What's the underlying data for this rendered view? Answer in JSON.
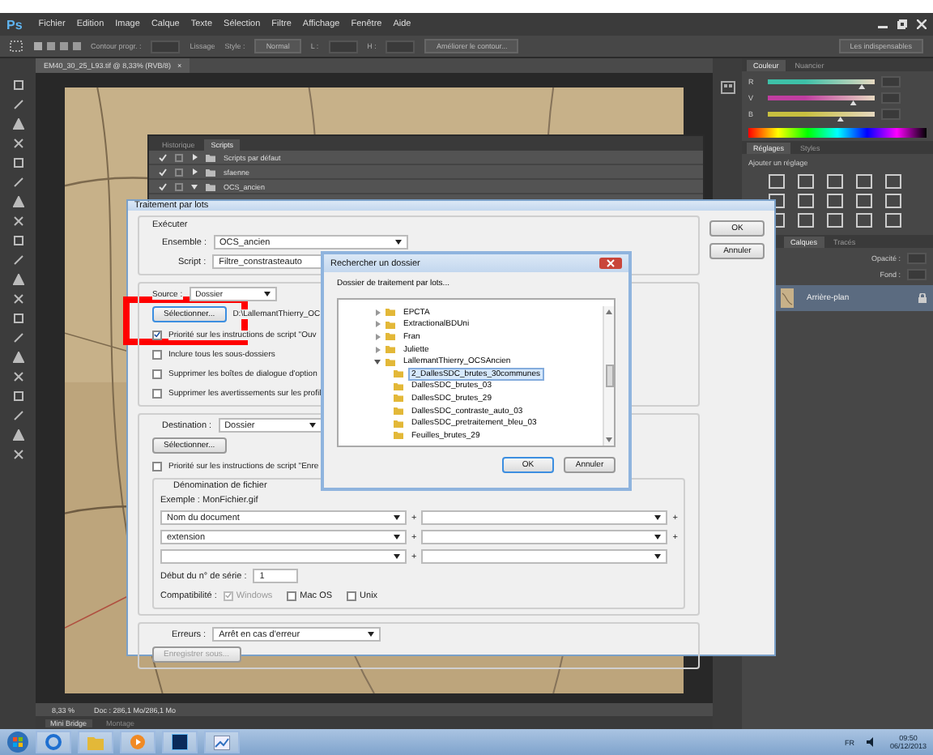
{
  "menu_bar": {
    "logo": "Ps",
    "items": [
      "Fichier",
      "Edition",
      "Image",
      "Calque",
      "Texte",
      "Sélection",
      "Filtre",
      "Affichage",
      "Fenêtre",
      "Aide"
    ]
  },
  "options_bar": {
    "feather_label": "Contour progr. :",
    "smooth": "Lissage",
    "style_label": "Style :",
    "style_value": "Normal",
    "width_label": "L :",
    "height_label": "H :",
    "refine": "Améliorer le contour...",
    "workspace": "Les indispensables"
  },
  "document_tab": {
    "title": "EM40_30_25_L93.tif @ 8,33% (RVB/8)",
    "close": "×"
  },
  "status_bar": {
    "zoom": "8,33 %",
    "doc": "Doc : 286,1 Mo/286,1 Mo"
  },
  "bottom_tabs": [
    {
      "label": "Mini Bridge",
      "selected": true
    },
    {
      "label": "Montage",
      "selected": false
    }
  ],
  "scripts_panel": {
    "tabs": [
      {
        "label": "Historique",
        "selected": false
      },
      {
        "label": "Scripts",
        "selected": true
      }
    ],
    "rows": [
      {
        "label": "Scripts par défaut",
        "expanded": false
      },
      {
        "label": "sfaenne",
        "expanded": false
      },
      {
        "label": "OCS_ancien",
        "expanded": true
      }
    ]
  },
  "batch_dialog": {
    "title": "Traitement par lots",
    "buttons": [
      "OK",
      "Annuler"
    ],
    "execute": {
      "legend": "Exécuter",
      "set_label": "Ensemble :",
      "set_value": "OCS_ancien",
      "script_label": "Script :",
      "script_value": "Filtre_constrasteauto"
    },
    "source": {
      "label": "Source :",
      "value": "Dossier",
      "select": "Sélectionner...",
      "path": "D:\\LallemantThierry_OC",
      "options": [
        {
          "label": "Priorité sur les instructions de script \"Ouv",
          "checked": true
        },
        {
          "label": "Inclure tous les sous-dossiers",
          "checked": false
        },
        {
          "label": "Supprimer les boîtes de dialogue d'option",
          "checked": false
        },
        {
          "label": "Supprimer les avertissements sur les profil",
          "checked": false
        }
      ]
    },
    "destination": {
      "label": "Destination :",
      "value": "Dossier",
      "select": "Sélectionner...",
      "override": {
        "label": "Priorité sur les instructions de script \"Enre",
        "checked": false
      },
      "naming": {
        "legend": "Dénomination de fichier",
        "example": "Exemple : MonFichier.gif",
        "rows": [
          {
            "value": "Nom du document",
            "plus": "+",
            "end_plus": "+"
          },
          {
            "value": "extension",
            "plus": "+",
            "end_plus": "+"
          },
          {
            "plus": "+"
          }
        ]
      },
      "serial_label": "Début du n° de série :",
      "serial_value": "1",
      "compat_label": "Compatibilité :",
      "compat": [
        {
          "label": "Windows",
          "checked": true,
          "disabled": true
        },
        {
          "label": "Mac OS",
          "checked": false,
          "disabled": false
        },
        {
          "label": "Unix",
          "checked": false,
          "disabled": false
        }
      ]
    },
    "errors": {
      "label": "Erreurs :",
      "value": "Arrêt en cas d'erreur",
      "save": "Enregistrer sous...",
      "save_disabled": true
    }
  },
  "folder_dialog": {
    "title": "Rechercher un dossier",
    "prompt": "Dossier de traitement par lots...",
    "buttons": [
      "OK",
      "Annuler"
    ],
    "tree": [
      {
        "label": "EPCTA",
        "expanded": false,
        "selected": false
      },
      {
        "label": "ExtractionalBDUni",
        "expanded": false,
        "selected": false
      },
      {
        "label": "Fran",
        "expanded": false,
        "selected": false
      },
      {
        "label": "Juliette",
        "expanded": false,
        "selected": false
      },
      {
        "label": "LallemantThierry_OCSAncien",
        "expanded": true,
        "selected": false,
        "children": [
          {
            "label": "2_DallesSDC_brutes_30communes",
            "selected": true
          },
          {
            "label": "DallesSDC_brutes_03",
            "selected": false
          },
          {
            "label": "DallesSDC_brutes_29",
            "selected": false
          },
          {
            "label": "DallesSDC_contraste_auto_03",
            "selected": false
          },
          {
            "label": "DallesSDC_pretraitement_bleu_03",
            "selected": false
          },
          {
            "label": "Feuilles_brutes_29",
            "selected": false
          }
        ]
      }
    ]
  },
  "color_panel": {
    "tabs": [
      {
        "label": "Couleur",
        "selected": true
      },
      {
        "label": "Nuancier",
        "selected": false
      }
    ],
    "sliders": [
      {
        "label": "R",
        "level": 0.88,
        "color": "#3ec0a8"
      },
      {
        "label": "V",
        "level": 0.8,
        "color": "#c03ea0"
      },
      {
        "label": "B",
        "level": 0.68,
        "color": "#c8c040"
      }
    ]
  },
  "adjust_panel": {
    "tabs": [
      {
        "label": "Réglages",
        "selected": true
      },
      {
        "label": "Styles",
        "selected": false
      }
    ],
    "heading": "Ajouter un réglage"
  },
  "layers_panel": {
    "tabs": [
      {
        "label": "Calques",
        "selected": true
      },
      {
        "label": "Tracés",
        "selected": false
      }
    ],
    "opacity_label": "Opacité :",
    "fill_label": "Fond :",
    "layers": [
      {
        "name": "Arrière-plan",
        "selected": true
      }
    ]
  },
  "taskbar": {
    "language": "FR",
    "time": "09:50",
    "date": "06/12/2013"
  }
}
